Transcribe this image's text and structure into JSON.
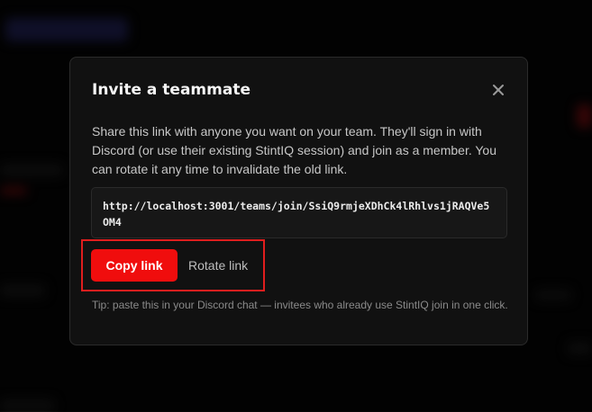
{
  "modal": {
    "title": "Invite a teammate",
    "close_icon": "close-icon",
    "description": "Share this link with anyone you want on your team. They'll sign in with Discord (or use their existing StintIQ session) and join as a member. You can rotate it any time to invalidate the old link.",
    "invite_link": "http://localhost:3001/teams/join/SsiQ9rmjeXDhCk4lRhlvs1jRAQVe5OM4",
    "copy_button_label": "Copy link",
    "rotate_button_label": "Rotate link",
    "tip": "Tip: paste this in your Discord chat — invitees who already use StintIQ join in one click."
  },
  "colors": {
    "accent": "#f00d0d",
    "highlight": "#e01e1e",
    "modal_bg": "#111111",
    "page_bg": "#050505"
  }
}
